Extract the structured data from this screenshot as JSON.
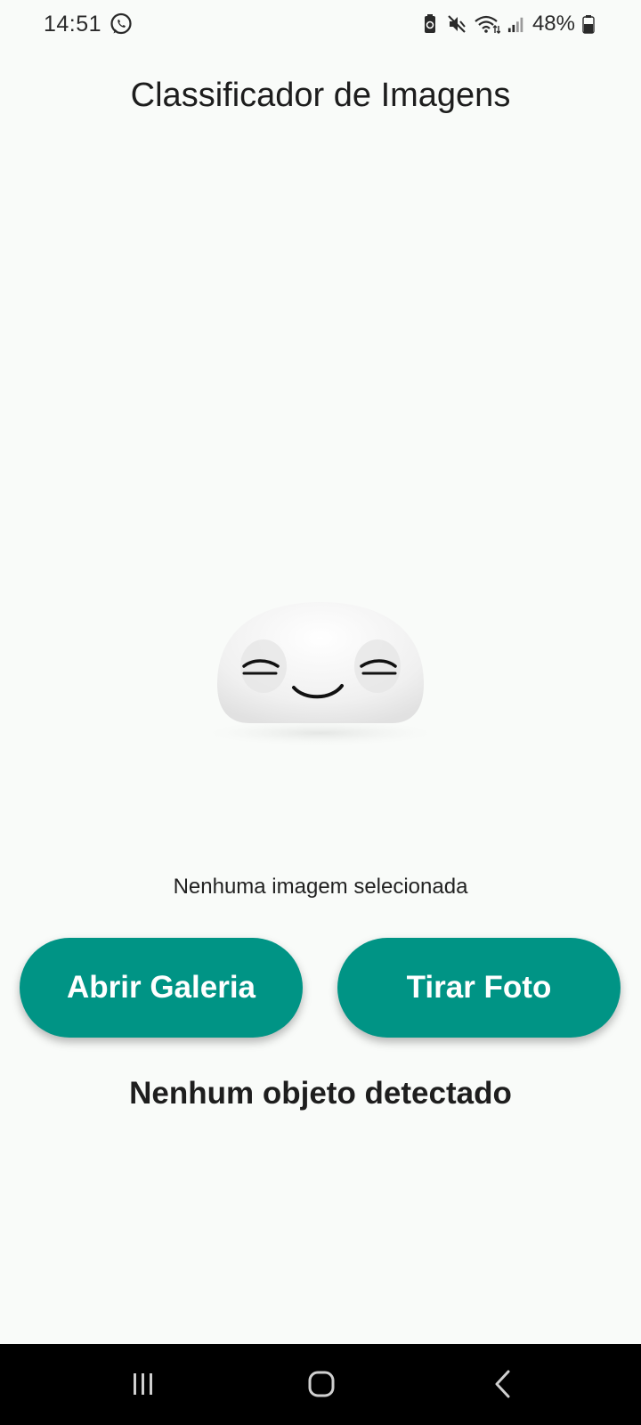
{
  "status_bar": {
    "time": "14:51",
    "battery": "48%",
    "icons": [
      "whatsapp-icon",
      "battery-saver-icon",
      "mute-icon",
      "wifi-icon",
      "signal-icon",
      "battery-icon"
    ]
  },
  "app": {
    "title": "Classificador de Imagens"
  },
  "image_area": {
    "placeholder_icon": "smiling-blob-icon",
    "status_text": "Nenhuma imagem selecionada"
  },
  "actions": {
    "gallery_label": "Abrir Galeria",
    "camera_label": "Tirar Foto"
  },
  "result": {
    "text": "Nenhum objeto detectado"
  },
  "nav_bar": {
    "icons": [
      "recents-icon",
      "home-icon",
      "back-icon"
    ]
  },
  "colors": {
    "background": "#f9fbf9",
    "accent": "#009485",
    "nav_bar": "#000000"
  }
}
